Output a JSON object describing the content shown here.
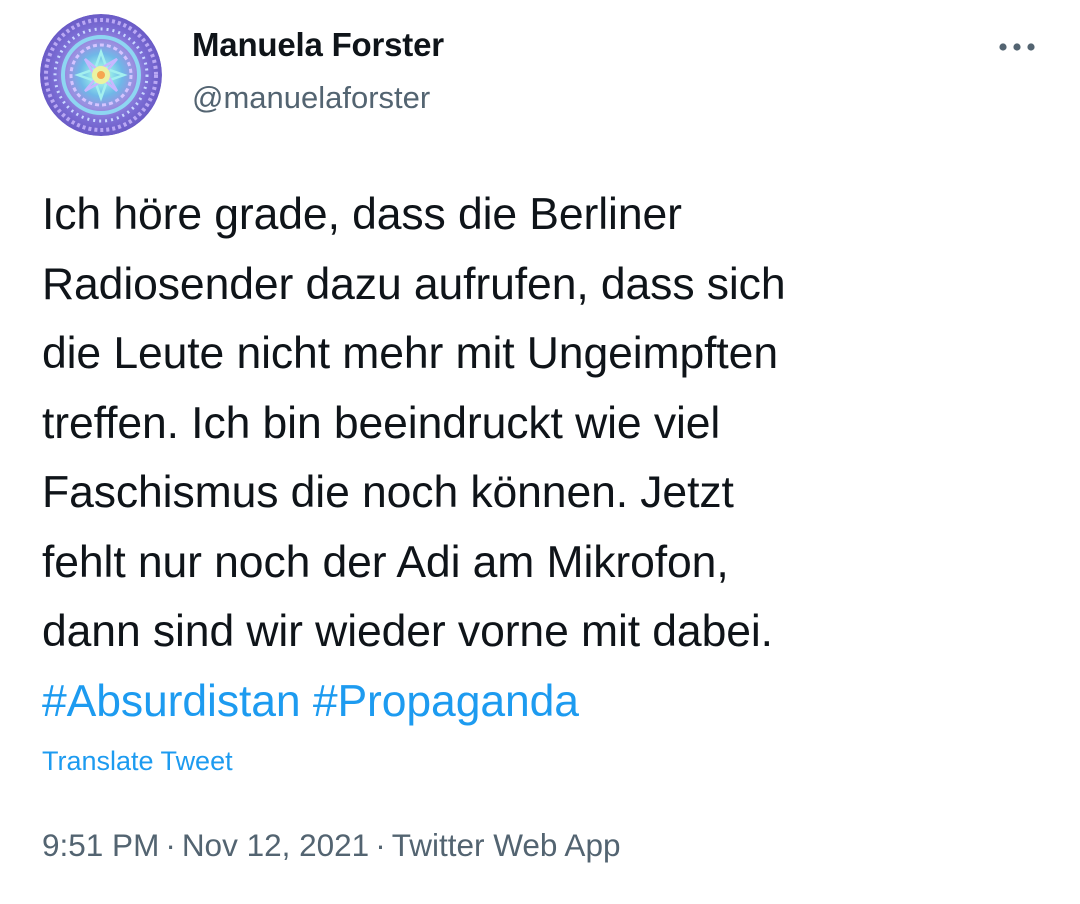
{
  "author": {
    "display_name": "Manuela Forster",
    "handle": "@manuelaforster",
    "avatar_icon": "mandala-avatar"
  },
  "header": {
    "more_icon": "more-horizontal-icon"
  },
  "tweet": {
    "lines": [
      "Ich höre grade, dass die Berliner",
      "Radiosender dazu aufrufen, dass sich",
      "die Leute nicht mehr mit Ungeimpften",
      "treffen. Ich bin beeindruckt wie viel",
      "Faschismus die noch können. Jetzt",
      "fehlt nur noch der Adi am Mikrofon,",
      "dann sind wir wieder vorne mit dabei."
    ],
    "hashtags": [
      "#Absurdistan",
      "#Propaganda"
    ],
    "translate_label": "Translate Tweet"
  },
  "meta": {
    "time": "9:51 PM",
    "separator": "·",
    "date": "Nov 12, 2021",
    "source": "Twitter Web App"
  },
  "colors": {
    "link": "#1d9bf0",
    "secondary_text": "#536471",
    "primary_text": "#0f1419"
  }
}
